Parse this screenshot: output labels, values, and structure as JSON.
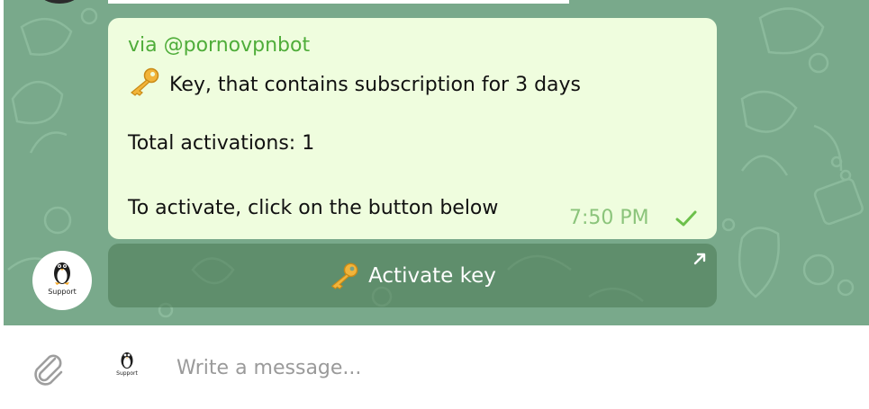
{
  "message": {
    "via": "via @pornovpnbot",
    "line1": "Key, that contains subscription for 3 days",
    "line2_label": "Total activations:",
    "line2_value": "1",
    "line3": "To activate, click on the button below",
    "time": "7:50 PM"
  },
  "sender": {
    "avatar_caption": "Support"
  },
  "inline_button": {
    "label": "Activate key"
  },
  "composer": {
    "placeholder": "Write a message...",
    "sendas_caption": "Support"
  },
  "icons": {
    "key": "key-emoji-icon",
    "check": "single-check-icon",
    "attach": "paperclip-icon",
    "link_arrow": "arrow-up-right-icon"
  },
  "colors": {
    "chat_background": "#79a98b",
    "bubble": "#effdde",
    "via_link": "#4fad3a",
    "time": "#8bc47b",
    "inline_button": "#5d8a66"
  }
}
